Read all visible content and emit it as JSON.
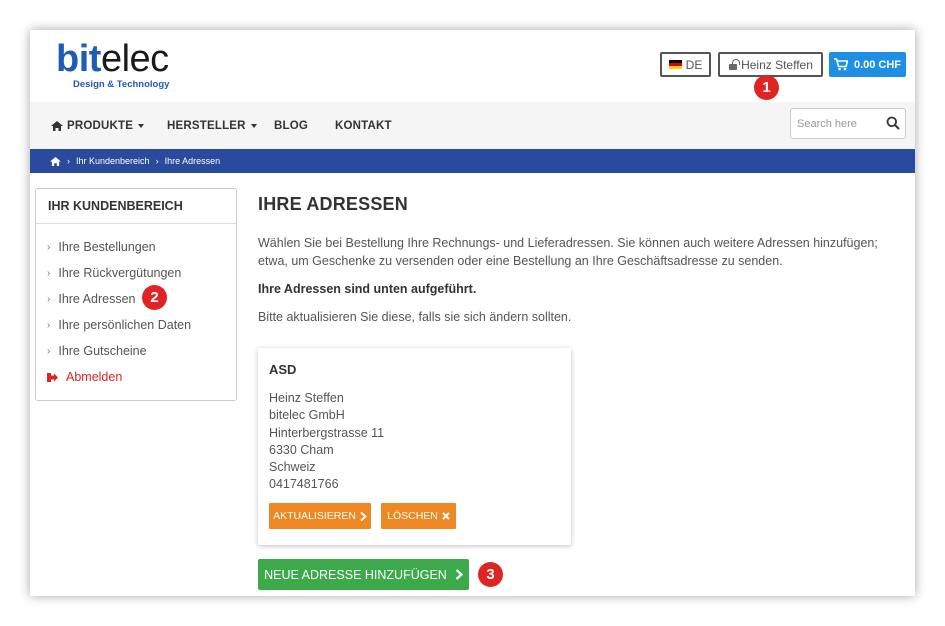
{
  "header": {
    "logo": {
      "part1": "bit",
      "part2": "elec",
      "tagline": "Design & Technology"
    },
    "language": "DE",
    "user_name": "Heinz Steffen",
    "cart_total": "0.00 CHF",
    "badge_1": "1"
  },
  "nav": {
    "items": [
      {
        "label": "PRODUKTE",
        "dropdown": true
      },
      {
        "label": "HERSTELLER",
        "dropdown": true
      },
      {
        "label": "BLOG",
        "dropdown": false
      },
      {
        "label": "KONTAKT",
        "dropdown": false
      }
    ],
    "search_placeholder": "Search here"
  },
  "breadcrumb": {
    "items": [
      "Ihr Kundenbereich",
      "Ihre Adressen"
    ],
    "separator": "›"
  },
  "sidebar": {
    "title": "IHR KUNDENBEREICH",
    "items": [
      "Ihre Bestellungen",
      "Ihre Rückvergütungen",
      "Ihre Adressen",
      "Ihre persönlichen Daten",
      "Ihre Gutscheine"
    ],
    "logout": "Abmelden",
    "badge_2": "2"
  },
  "main": {
    "title": "IHRE ADRESSEN",
    "intro": "Wählen Sie bei Bestellung Ihre Rechnungs- und Lieferadressen. Sie können auch weitere Adressen hinzufügen; etwa, um Geschenke zu versenden oder eine Bestellung an Ihre Geschäftsadresse zu senden.",
    "bold_line": "Ihre Adressen sind unten aufgeführt.",
    "update_line": "Bitte aktualisieren Sie diese, falls sie sich ändern sollten.",
    "address": {
      "title": "ASD",
      "lines": [
        "Heinz Steffen",
        "bitelec GmbH",
        "Hinterbergstrasse 11",
        "6330 Cham",
        "Schweiz",
        "0417481766"
      ],
      "update_label": "AKTUALISIEREN",
      "delete_label": "LÖSCHEN"
    },
    "add_label": "NEUE ADRESSE HINZUFÜGEN",
    "badge_3": "3"
  },
  "colors": {
    "brand_blue": "#1f5cb4",
    "breadcrumb_bg": "#2a4a9e",
    "cart_blue": "#1f8fe5",
    "orange": "#ee8822",
    "green": "#3caa4a",
    "badge_red": "#e02424"
  },
  "icons": {
    "flag": "german-flag-icon",
    "lock": "unlock-icon",
    "cart": "shopping-cart-icon",
    "home": "home-icon",
    "search": "search-icon",
    "logout": "sign-out-icon",
    "chevron": "chevron-right-icon",
    "delete": "times-icon"
  }
}
